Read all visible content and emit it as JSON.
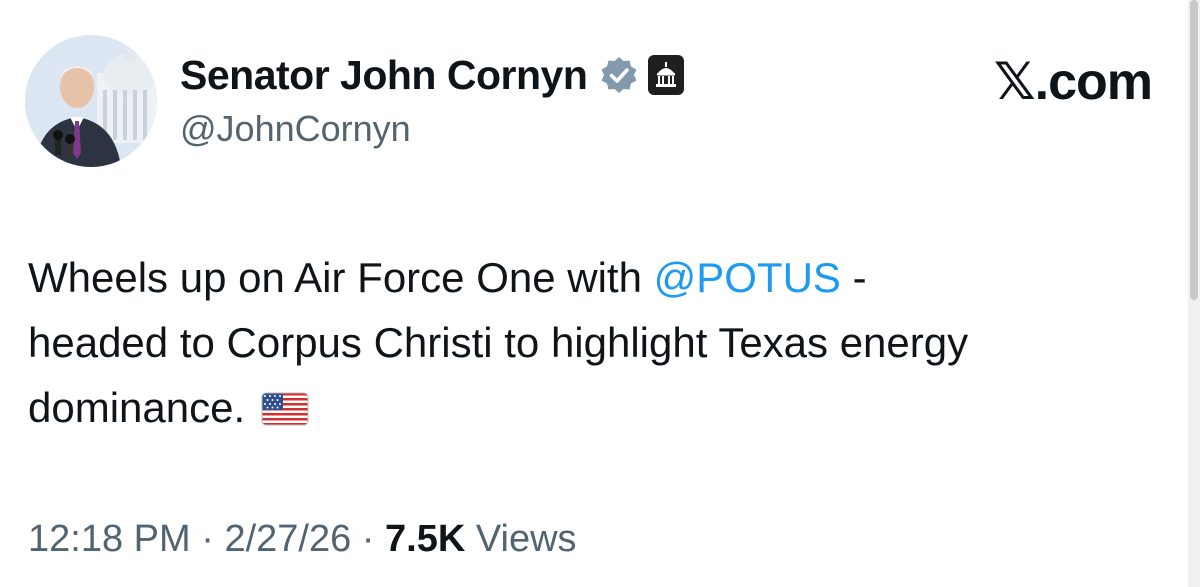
{
  "author": {
    "display_name": "Senator John Cornyn",
    "handle": "@JohnCornyn",
    "verified_icon": "verified-badge-icon",
    "affiliation_icon": "government-building-icon",
    "avatar_alt": "profile photo"
  },
  "brand": {
    "label": "𝕏.com"
  },
  "tweet": {
    "text_before_mention": "Wheels up on Air Force One with ",
    "mention": "@POTUS",
    "text_after_mention": " -\nheaded to Corpus Christi to highlight Texas energy\ndominance. ",
    "emoji_icon": "us-flag-icon"
  },
  "meta": {
    "time": "12:18 PM",
    "separator": " · ",
    "date": "2/27/26",
    "views_count": "7.5K",
    "views_label": " Views"
  },
  "colors": {
    "text": "#0f1419",
    "secondary": "#536471",
    "link": "#1d9bf0",
    "verified": "#829aab"
  }
}
